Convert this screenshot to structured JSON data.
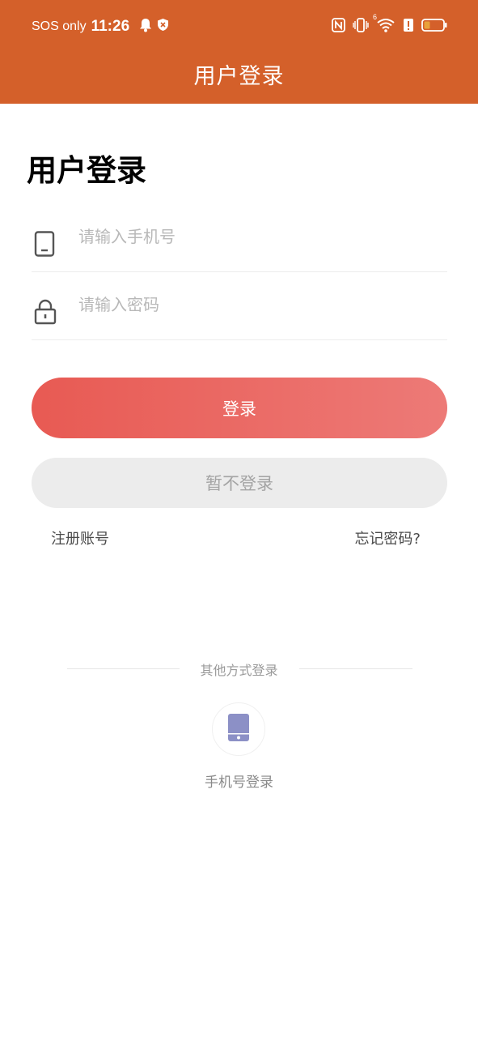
{
  "status_bar": {
    "carrier": "SOS only",
    "time": "11:26",
    "wifi_label": "6",
    "battery_color": "#E8A23A"
  },
  "header": {
    "title": "用户登录",
    "bg_color": "#D4602A"
  },
  "main": {
    "heading": "用户登录",
    "phone_field": {
      "placeholder": "请输入手机号",
      "value": "",
      "icon": "phone-icon"
    },
    "password_field": {
      "placeholder": "请输入密码",
      "value": "",
      "icon": "lock-icon"
    },
    "login_button": "登录",
    "skip_button": "暂不登录",
    "register_link": "注册账号",
    "forgot_link": "忘记密码?"
  },
  "other_login": {
    "label": "其他方式登录",
    "phone_login": {
      "label": "手机号登录",
      "icon": "phone-icon"
    }
  },
  "colors": {
    "accent": "#D4602A",
    "button_gradient_start": "#E85A53",
    "button_gradient_end": "#ED7A77",
    "phone_icon": "#8C90C6"
  }
}
